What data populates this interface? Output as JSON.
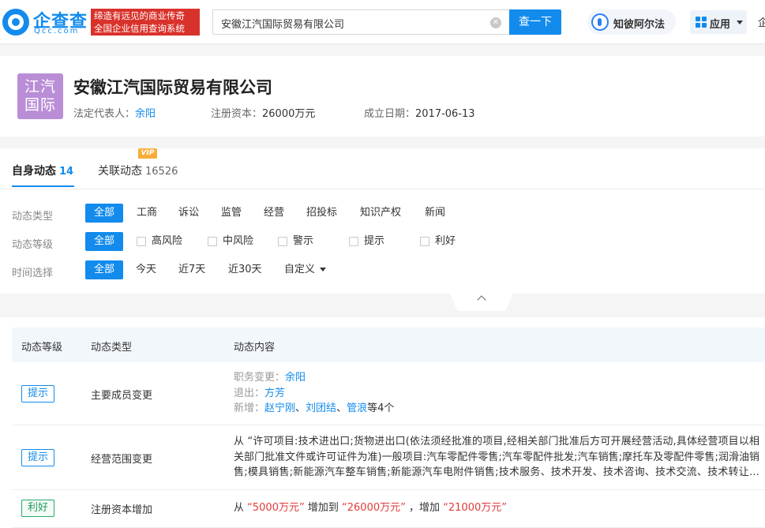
{
  "header": {
    "logo_name": "企查查",
    "logo_domain": "Qcc.com",
    "slogan_line1": "缔造有远见的商业传奇",
    "slogan_line2": "全国企业信用查询系统",
    "search_value": "安徽江汽国际贸易有限公司",
    "search_button": "查一下",
    "ai_label": "知彼阿尔法",
    "app_label": "应用",
    "more_text": "企"
  },
  "company": {
    "logo_line1": "江汽",
    "logo_line2": "国际",
    "name": "安徽江汽国际贸易有限公司",
    "legal_rep_label": "法定代表人：",
    "legal_rep": "余阳",
    "capital_label": "注册资本：",
    "capital": "26000万元",
    "founded_label": "成立日期：",
    "founded": "2017-06-13"
  },
  "tabs": [
    {
      "label": "自身动态",
      "count": "14"
    },
    {
      "label": "关联动态",
      "count": "16526",
      "badge": "VIP"
    }
  ],
  "filters": {
    "type": {
      "label": "动态类型",
      "options": [
        "全部",
        "工商",
        "诉讼",
        "监管",
        "经营",
        "招投标",
        "知识产权",
        "新闻"
      ]
    },
    "level": {
      "label": "动态等级",
      "all": "全部",
      "options": [
        "高风险",
        "中风险",
        "警示",
        "提示",
        "利好"
      ]
    },
    "time": {
      "label": "时间选择",
      "options": [
        "全部",
        "今天",
        "近7天",
        "近30天",
        "自定义"
      ]
    }
  },
  "table": {
    "headers": [
      "动态等级",
      "动态类型",
      "动态内容"
    ],
    "rows": [
      {
        "level": "提示",
        "type": "主要成员变更",
        "lines": [
          {
            "label": "职务变更：",
            "value": "余阳"
          },
          {
            "label": "退出：",
            "value": "方芳"
          },
          {
            "label": "新增：",
            "names": [
              "赵宁刚",
              "刘团结",
              "管浪"
            ],
            "suffix": "等4个"
          }
        ]
      },
      {
        "level": "提示",
        "type": "经营范围变更",
        "text": "从 “许可项目:技术进出口;货物进出口(依法须经批准的项目,经相关部门批准后方可开展经营活动,具体经营项目以相关部门批准文件或许可证件为准)一般项目:汽车零配件零售;汽车零配件批发;汽车销售;摩托车及零配件零售;润滑油销售;模具销售;新能源汽车整车销售;新能源汽车电附件销售;技术服务、技术开发、技术咨询、技术交流、技术转让、技术推广..."
      },
      {
        "level": "利好",
        "type": "注册资本增加",
        "from_prefix": "从",
        "from_value": "“5000万元”",
        "mid": "增加到",
        "to_value": "“26000万元”",
        "sep": "，增加",
        "delta_value": "“21000万元”"
      }
    ]
  },
  "colors": {
    "primary": "#128bed",
    "slogan_bg": "#d9322b",
    "company_logo_bg": "#b98ed6",
    "positive": "#1e9b5b",
    "highlight": "#e23b3b"
  }
}
